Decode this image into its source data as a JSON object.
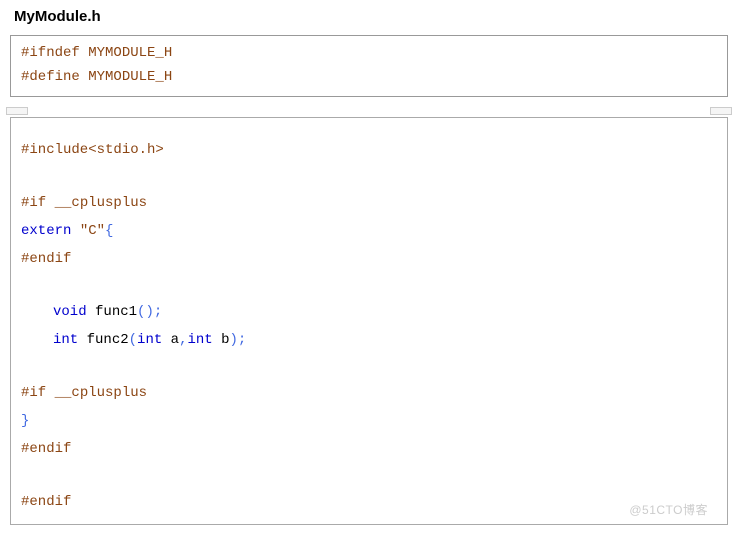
{
  "title": "MyModule.h",
  "block1": {
    "line1": {
      "directive": "#ifndef",
      "macro": "MYMODULE_H"
    },
    "line2": {
      "directive": "#define",
      "macro": "MYMODULE_H"
    }
  },
  "block2": {
    "include": {
      "directive": "#include",
      "header": "<stdio.h>"
    },
    "if_cpp1": {
      "directive": "#if",
      "cond": "__cplusplus"
    },
    "extern": {
      "keyword": "extern",
      "lang": "\"C\"",
      "brace": "{"
    },
    "endif1": "#endif",
    "func1": {
      "ret": "void",
      "name": "func1",
      "open": "(",
      "close": ")",
      "semi": ";"
    },
    "func2": {
      "ret": "int",
      "name": "func2",
      "open": "(",
      "p1type": "int",
      "p1name": "a",
      "comma": ",",
      "p2type": "int",
      "p2name": "b",
      "close": ")",
      "semi": ";"
    },
    "if_cpp2": {
      "directive": "#if",
      "cond": "__cplusplus"
    },
    "close_brace": "}",
    "endif2": "#endif",
    "endif3": "#endif"
  },
  "watermark": "@51CTO博客"
}
